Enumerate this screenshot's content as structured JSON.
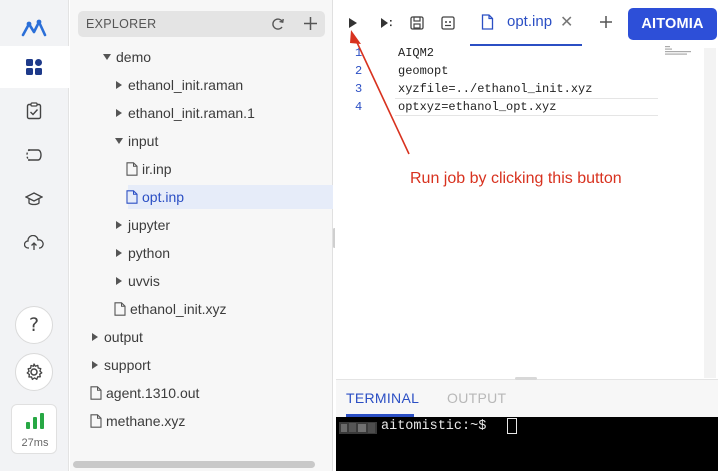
{
  "activity_bar": {
    "items": [
      "logo-icon",
      "dashboard-icon",
      "clipboard-check-icon",
      "workflow-icon",
      "graduation-cap-icon",
      "cloud-upload-icon"
    ],
    "help_icon": "question-icon",
    "settings_icon": "gear-icon",
    "latency": "27ms"
  },
  "explorer": {
    "title": "EXPLORER",
    "tree": [
      {
        "label": "demo",
        "type": "folder",
        "expanded": true
      },
      {
        "label": "ethanol_init.raman",
        "type": "folder",
        "expanded": false
      },
      {
        "label": "ethanol_init.raman.1",
        "type": "folder",
        "expanded": false
      },
      {
        "label": "input",
        "type": "folder",
        "expanded": true
      },
      {
        "label": "ir.inp",
        "type": "file"
      },
      {
        "label": "opt.inp",
        "type": "file",
        "selected": true
      },
      {
        "label": "jupyter",
        "type": "folder",
        "expanded": false
      },
      {
        "label": "python",
        "type": "folder",
        "expanded": false
      },
      {
        "label": "uvvis",
        "type": "folder",
        "expanded": false
      },
      {
        "label": "ethanol_init.xyz",
        "type": "file"
      },
      {
        "label": "output",
        "type": "folder",
        "expanded": false
      },
      {
        "label": "support",
        "type": "folder",
        "expanded": false
      },
      {
        "label": "agent.1310.out",
        "type": "file"
      },
      {
        "label": "methane.xyz",
        "type": "file"
      }
    ]
  },
  "editor": {
    "tab_label": "opt.inp",
    "tab_close": "✕",
    "brand_button": "AITOMIA",
    "line_numbers": [
      "1",
      "2",
      "3",
      "4"
    ],
    "lines": [
      "AIQM2",
      "geomopt",
      "xyzfile=../ethanol_init.xyz",
      "optxyz=ethanol_opt.xyz"
    ],
    "annotation": "Run job by clicking this button",
    "accent_color": "#2d4fd8",
    "annotation_color": "#d8321f"
  },
  "panel": {
    "tabs": [
      "TERMINAL",
      "OUTPUT"
    ],
    "active_tab": "TERMINAL",
    "prompt": "aitomistic:~$ "
  }
}
